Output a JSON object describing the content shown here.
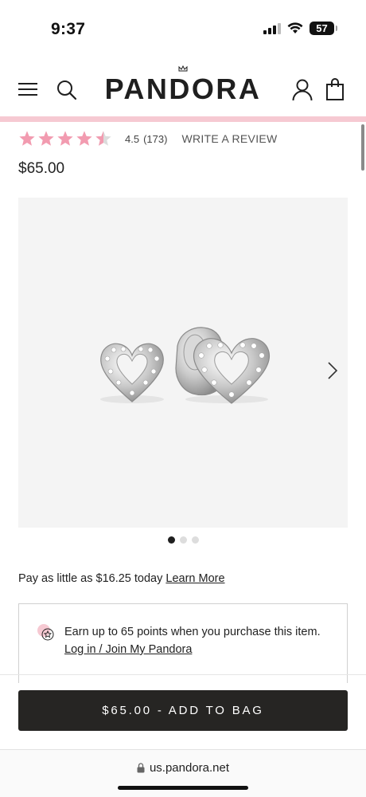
{
  "status_bar": {
    "time": "9:37",
    "battery": "57",
    "icons": [
      "signal-icon",
      "wifi-icon",
      "battery-icon"
    ]
  },
  "header": {
    "brand": "PANDORA",
    "icons": [
      "menu-icon",
      "search-icon",
      "account-icon",
      "bag-icon"
    ],
    "accent_color": "#f6c9d2"
  },
  "rating": {
    "stars": 4.5,
    "value": "4.5",
    "count": "(173)",
    "write_review": "WRITE A REVIEW",
    "star_color": "#f29bb0"
  },
  "product": {
    "price": "$65.00",
    "image_alt": "Open heart stud earrings",
    "carousel_index": 1,
    "carousel_total": 3
  },
  "payment": {
    "text": "Pay as little as $16.25 today",
    "link": "Learn More"
  },
  "points": {
    "text": "Earn up to 65 points when you purchase this item.",
    "link": "Log in / Join My Pandora"
  },
  "cta": {
    "label": "$65.00 - ADD TO BAG",
    "color": "#262523"
  },
  "browser": {
    "url": "us.pandora.net"
  }
}
